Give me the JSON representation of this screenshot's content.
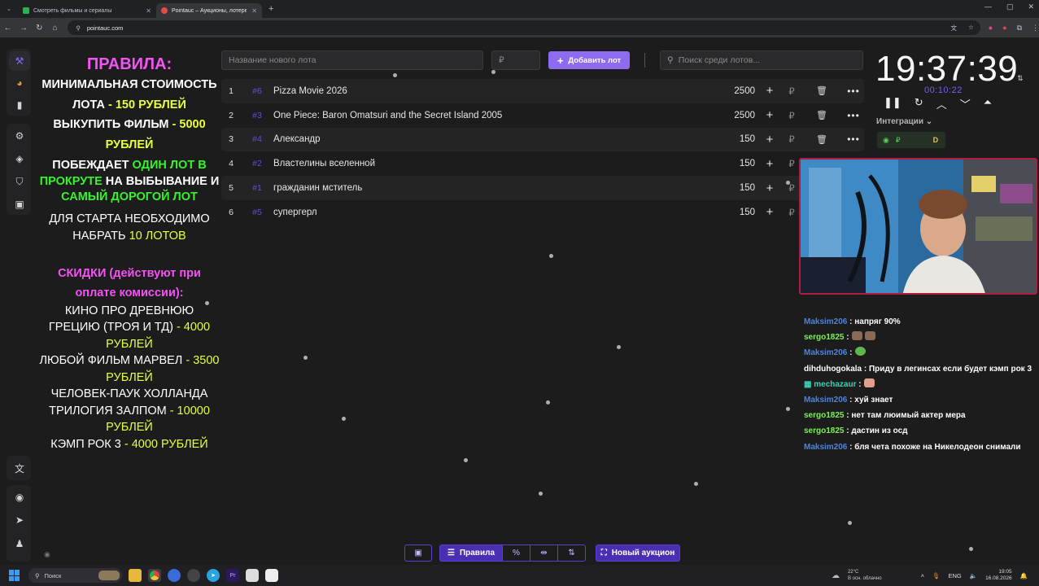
{
  "browser": {
    "tabs": [
      {
        "title": "Смотреть фильмы и сериалы",
        "active": false
      },
      {
        "title": "Pointauc – Аукционы, лотере",
        "active": true
      }
    ],
    "url": "pointauc.com"
  },
  "rules": {
    "heading": "ПРАВИЛА:",
    "min_cost_label": "МИНИМАЛЬНАЯ СТОИМОСТЬ ЛОТА",
    "min_cost_value": "- 150 РУБЛЕЙ",
    "buyout_label": "ВЫКУПИТЬ ФИЛЬМ",
    "buyout_value": "- 5000 РУБЛЕЙ",
    "win_part1": "ПОБЕЖДАЕТ",
    "win_part2": "ОДИН ЛОТ В ПРОКРУТЕ",
    "win_part3": "НА ВЫБЫВАНИЕ И",
    "win_part4": "САМЫЙ ДОРОГОЙ ЛОТ",
    "start_label": "ДЛЯ СТАРТА НЕОБХОДИМО НАБРАТЬ",
    "start_value": "10 ЛОТОВ",
    "discounts_heading": "СКИДКИ (действуют при оплате комиссии):",
    "discounts": [
      {
        "label": "КИНО ПРО ДРЕВНЮЮ ГРЕЦИЮ (ТРОЯ И ТД)",
        "value": "- 4000 РУБЛЕЙ"
      },
      {
        "label": "ЛЮБОЙ ФИЛЬМ МАРВЕЛ",
        "value": "- 3500 РУБЛЕЙ"
      },
      {
        "label": "ЧЕЛОВЕК-ПАУК ХОЛЛАНДА ТРИЛОГИЯ ЗАЛПОМ",
        "value": "- 10000 РУБЛЕЙ"
      },
      {
        "label": "КЭМП РОК 3",
        "value": "- 4000 РУБЛЕЙ"
      }
    ]
  },
  "toolbar": {
    "lot_name_placeholder": "Название нового лота",
    "amount_placeholder": "₽",
    "add_button": "Добавить лот",
    "search_placeholder": "Поиск среди лотов..."
  },
  "lots": [
    {
      "index": "1",
      "fast_id": "#6",
      "name": "Pizza Movie 2026",
      "amount": "2500",
      "currency": "₽",
      "trash": true
    },
    {
      "index": "2",
      "fast_id": "#3",
      "name": "One Piece: Baron Omatsuri and the Secret Island 2005",
      "amount": "2500",
      "currency": "₽",
      "trash": true
    },
    {
      "index": "3",
      "fast_id": "#4",
      "name": "Александр",
      "amount": "150",
      "currency": "₽",
      "trash": true
    },
    {
      "index": "4",
      "fast_id": "#2",
      "name": "Властелины вселенной",
      "amount": "150",
      "currency": "₽",
      "trash": false
    },
    {
      "index": "5",
      "fast_id": "#1",
      "name": "гражданин мститель",
      "amount": "150",
      "currency": "₽",
      "trash": false
    },
    {
      "index": "6",
      "fast_id": "#5",
      "name": "супергерл",
      "amount": "150",
      "currency": "₽",
      "trash": false
    }
  ],
  "timer": {
    "time": "19:37:39",
    "elapsed": "00:10:22"
  },
  "integrations": {
    "label": "Интеграции",
    "pill_currency": "₽",
    "pill_letter": "D"
  },
  "chat": [
    {
      "user": "Maksim206",
      "color": "blue",
      "text": ": напряг 90%",
      "emotes": 0
    },
    {
      "user": "sergo1825",
      "color": "green",
      "text": ":",
      "emotes": 2
    },
    {
      "user": "Maksim206",
      "color": "blue",
      "text": ":",
      "emotes": 1
    },
    {
      "user": "dihduhogokala",
      "color": "white",
      "text": ": Приду в легинсах если будет кэмп рок 3",
      "emotes": 0
    },
    {
      "user": "mechazaur",
      "color": "teal",
      "text": ":",
      "emotes": 1
    },
    {
      "user": "Maksim206",
      "color": "blue",
      "text": ": хуй знает",
      "emotes": 0
    },
    {
      "user": "sergo1825",
      "color": "green",
      "text": ": нет там люимый актер мера",
      "emotes": 0
    },
    {
      "user": "sergo1825",
      "color": "green",
      "text": ": дастин из осд",
      "emotes": 0
    },
    {
      "user": "Maksim206",
      "color": "blue",
      "text": ": бля чета похоже на Никелодеон снимали",
      "emotes": 0
    }
  ],
  "bottom": {
    "rules_button": "Правила",
    "percent_button": "%",
    "new_auction_button": "Новый аукцион"
  },
  "taskbar": {
    "search": "Поиск",
    "weather_temp": "22°C",
    "weather_desc": "В осн. облачно",
    "lang": "ENG",
    "time": "19:05",
    "date": "16.08.2026"
  },
  "colors": {
    "accent": "#8e6cf1",
    "rules_pink": "#f354f3",
    "rules_yellow": "#e8ff3a",
    "rules_green": "#35f52a",
    "webcam_border": "#b11d3f"
  }
}
